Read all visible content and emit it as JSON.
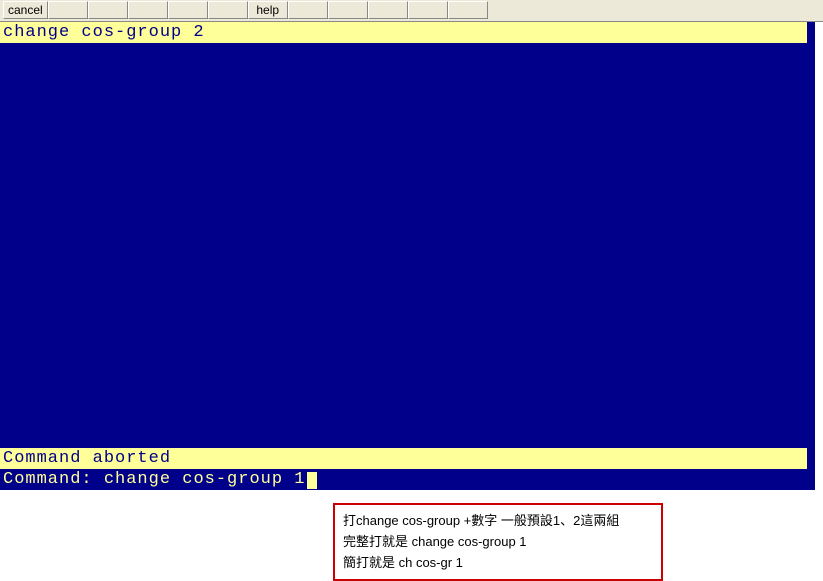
{
  "toolbar": {
    "buttons": [
      {
        "label": "cancel",
        "empty": false
      },
      {
        "label": "",
        "empty": true
      },
      {
        "label": "",
        "empty": true
      },
      {
        "label": "",
        "empty": true
      },
      {
        "label": "",
        "empty": true
      },
      {
        "label": "",
        "empty": true
      },
      {
        "label": "help",
        "empty": false
      },
      {
        "label": "",
        "empty": true
      },
      {
        "label": "",
        "empty": true
      },
      {
        "label": "",
        "empty": true
      },
      {
        "label": "",
        "empty": true
      },
      {
        "label": "",
        "empty": true
      }
    ]
  },
  "terminal": {
    "title_line": "change cos-group 2",
    "status_line": "Command aborted",
    "command_prompt": "Command: ",
    "command_input": "change cos-group 1"
  },
  "annotation": {
    "line1": "打change cos-group +數字  一般預設1、2這兩組",
    "line2": "完整打就是 change cos-group 1",
    "line3": "簡打就是 ch cos-gr 1"
  }
}
